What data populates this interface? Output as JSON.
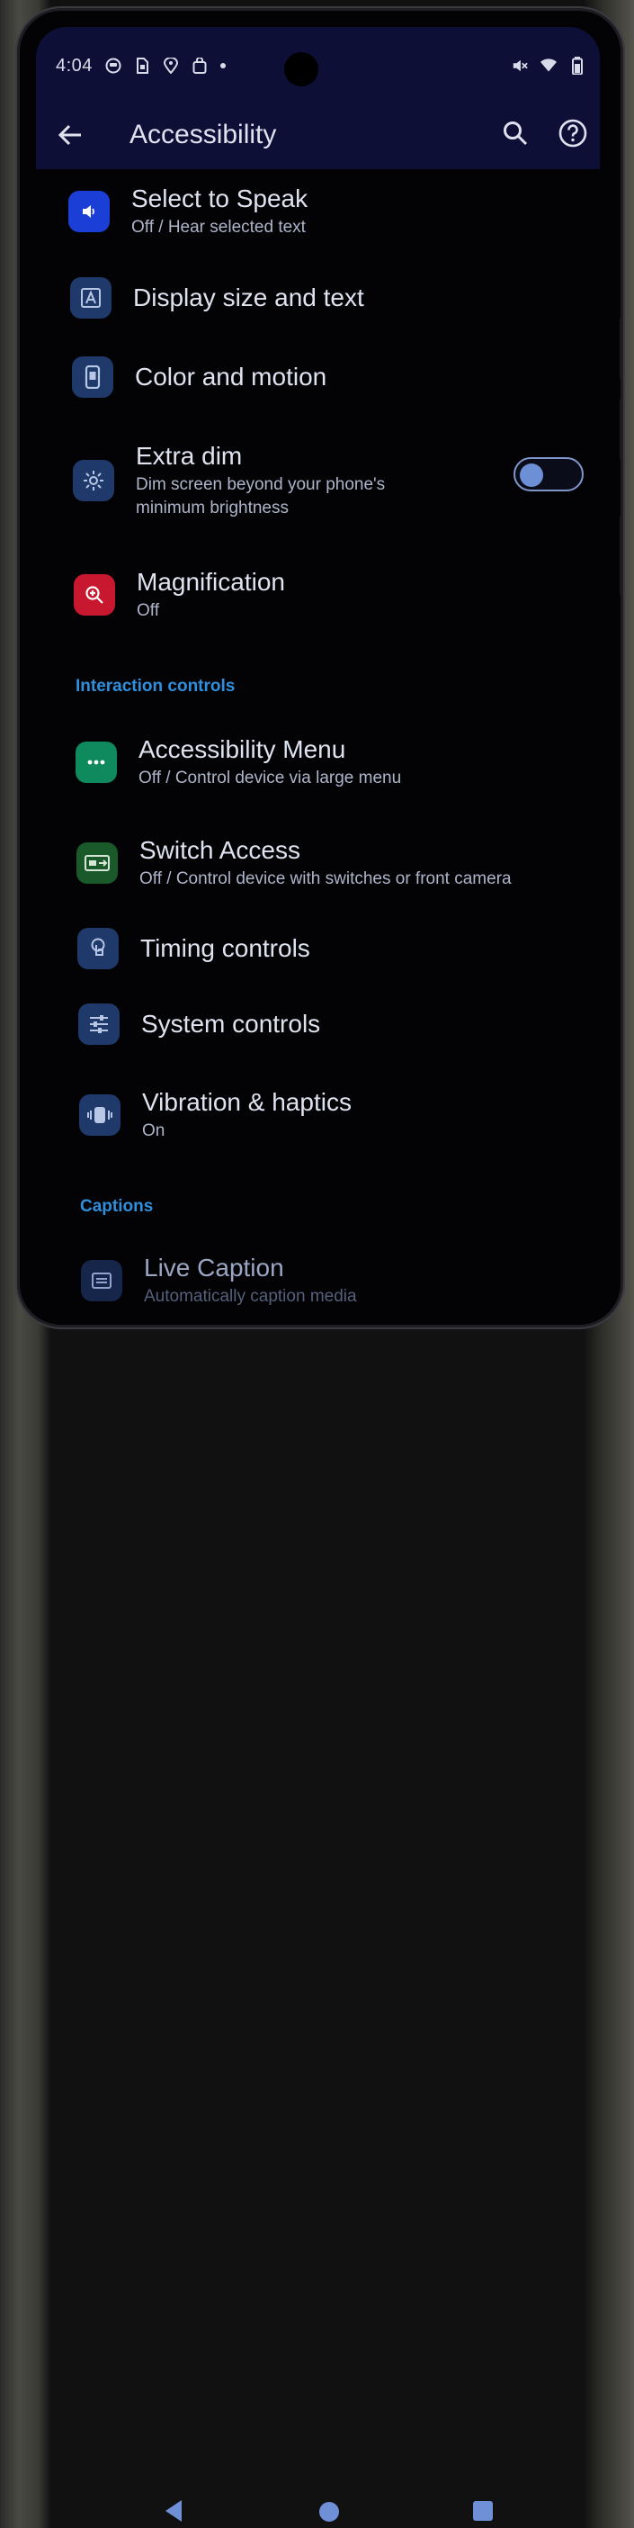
{
  "status_bar": {
    "time": "4:04",
    "left_icons": [
      "face-icon",
      "sim-icon",
      "location-icon",
      "bag-icon",
      "dot-icon"
    ],
    "right_icons": [
      "mute-icon",
      "wifi-icon",
      "battery-icon"
    ]
  },
  "app_bar": {
    "title": "Accessibility",
    "back_icon": "arrow-left-icon",
    "actions": [
      "search-icon",
      "help-icon"
    ]
  },
  "items": [
    {
      "title": "Select to Speak",
      "subtitle": "Off / Hear selected text",
      "icon": "speaker-icon",
      "color": "#1b3fd6"
    },
    {
      "title": "Display size and text",
      "icon": "text-size-icon",
      "color": "#1f3a6a"
    },
    {
      "title": "Color and motion",
      "icon": "phone-icon",
      "color": "#1f3a6a"
    },
    {
      "title": "Extra dim",
      "subtitle_line1": "Dim screen beyond your phone's",
      "subtitle_line2": "minimum brightness",
      "icon": "brightness-icon",
      "color": "#1f3a6a",
      "toggle": false
    },
    {
      "title": "Magnification",
      "subtitle": "Off",
      "icon": "magnify-icon",
      "color": "#c8182f"
    }
  ],
  "sections": {
    "interaction": "Interaction controls",
    "captions": "Captions"
  },
  "interaction_items": [
    {
      "title": "Accessibility Menu",
      "subtitle": "Off / Control device via large menu",
      "icon": "menu-dots-icon",
      "color": "#0f8a5e"
    },
    {
      "title": "Switch Access",
      "subtitle": "Off / Control device with switches or front camera",
      "icon": "switch-icon",
      "color": "#1a5a2a"
    },
    {
      "title": "Timing controls",
      "icon": "touch-icon",
      "color": "#1f3a6a"
    },
    {
      "title": "System controls",
      "icon": "sliders-icon",
      "color": "#1f3a6a"
    },
    {
      "title": "Vibration & haptics",
      "subtitle": "On",
      "icon": "vibrate-icon",
      "color": "#1f3a6a"
    }
  ],
  "caption_items": [
    {
      "title": "Live Caption",
      "subtitle": "Automatically caption media",
      "icon": "caption-icon",
      "color": "#1f3a6a"
    }
  ],
  "nav": [
    "back-nav-icon",
    "home-nav-icon",
    "recents-nav-icon"
  ]
}
